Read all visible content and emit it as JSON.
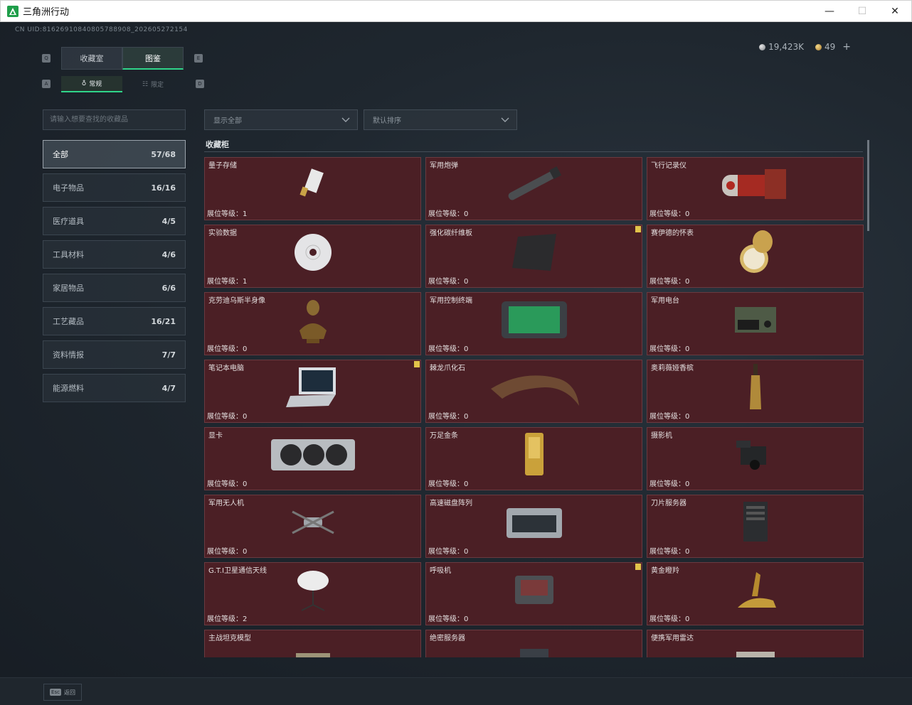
{
  "window": {
    "title": "三角洲行动",
    "minimize_glyph": "—",
    "maximize_glyph": "☐",
    "close_glyph": "✕"
  },
  "header": {
    "uid": "CN UID:8162691084080578890​8_2026052721​54",
    "silver_amount": "19,423K",
    "gold_amount": "49",
    "add_label": "+"
  },
  "tabs": {
    "key_left": "Q",
    "key_right": "E",
    "items": [
      {
        "label": "收藏室",
        "active": false
      },
      {
        "label": "图鉴",
        "active": true
      }
    ]
  },
  "subtabs": {
    "key_left": "A",
    "key_right": "D",
    "items": [
      {
        "label": "常规",
        "active": true
      },
      {
        "label": "限定",
        "active": false
      }
    ]
  },
  "search": {
    "placeholder": "请输入想要查找的收藏品"
  },
  "filters": {
    "display": "显示全部",
    "sort": "默认排序"
  },
  "categories": [
    {
      "label": "全部",
      "count": "57/68",
      "active": true
    },
    {
      "label": "电子物品",
      "count": "16/16",
      "active": false
    },
    {
      "label": "医疗道具",
      "count": "4/5",
      "active": false
    },
    {
      "label": "工具材料",
      "count": "4/6",
      "active": false
    },
    {
      "label": "家居物品",
      "count": "6/6",
      "active": false
    },
    {
      "label": "工艺藏品",
      "count": "16/21",
      "active": false
    },
    {
      "label": "资料情报",
      "count": "7/7",
      "active": false
    },
    {
      "label": "能源燃料",
      "count": "4/7",
      "active": false
    }
  ],
  "cabinet": {
    "title": "收藏柜",
    "level_prefix": "展位等级：",
    "items": [
      {
        "name": "量子存储",
        "level": "1",
        "flag": false,
        "icon": "usb-drive-icon"
      },
      {
        "name": "军用炮弹",
        "level": "0",
        "flag": false,
        "icon": "shell-icon"
      },
      {
        "name": "飞行记录仪",
        "level": "0",
        "flag": false,
        "icon": "flight-recorder-icon"
      },
      {
        "name": "实验数据",
        "level": "1",
        "flag": false,
        "icon": "disc-icon"
      },
      {
        "name": "强化碳纤维板",
        "level": "0",
        "flag": true,
        "icon": "carbon-plate-icon"
      },
      {
        "name": "赛伊德的怀表",
        "level": "0",
        "flag": false,
        "icon": "pocket-watch-icon"
      },
      {
        "name": "克劳迪乌斯半身像",
        "level": "0",
        "flag": false,
        "icon": "bust-icon"
      },
      {
        "name": "军用控制终端",
        "level": "0",
        "flag": false,
        "icon": "terminal-icon"
      },
      {
        "name": "军用电台",
        "level": "0",
        "flag": false,
        "icon": "radio-icon"
      },
      {
        "name": "笔记本电脑",
        "level": "0",
        "flag": true,
        "icon": "laptop-icon"
      },
      {
        "name": "棘龙爪化石",
        "level": "0",
        "flag": false,
        "icon": "claw-fossil-icon"
      },
      {
        "name": "奥莉薇娅香槟",
        "level": "0",
        "flag": false,
        "icon": "champagne-icon"
      },
      {
        "name": "显卡",
        "level": "0",
        "flag": false,
        "icon": "gpu-icon"
      },
      {
        "name": "万足金条",
        "level": "0",
        "flag": false,
        "icon": "gold-bar-icon"
      },
      {
        "name": "摄影机",
        "level": "0",
        "flag": false,
        "icon": "camera-icon"
      },
      {
        "name": "军用无人机",
        "level": "0",
        "flag": false,
        "icon": "drone-icon"
      },
      {
        "name": "高速磁盘阵列",
        "level": "0",
        "flag": false,
        "icon": "disk-array-icon"
      },
      {
        "name": "刀片服务器",
        "level": "0",
        "flag": false,
        "icon": "server-icon"
      },
      {
        "name": "G.T.I卫星通信天线",
        "level": "2",
        "flag": false,
        "icon": "satellite-dish-icon"
      },
      {
        "name": "呼吸机",
        "level": "0",
        "flag": true,
        "icon": "ventilator-icon"
      },
      {
        "name": "黄金瞪羚",
        "level": "0",
        "flag": false,
        "icon": "gold-gazelle-icon"
      },
      {
        "name": "主战坦克模型",
        "level": "",
        "flag": false,
        "icon": "tank-model-icon"
      },
      {
        "name": "绝密服务器",
        "level": "",
        "flag": false,
        "icon": "secret-server-icon"
      },
      {
        "name": "便携军用雷达",
        "level": "",
        "flag": false,
        "icon": "radar-icon"
      }
    ]
  },
  "footer": {
    "esc_key": "Esc",
    "back_label": "返回"
  },
  "colors": {
    "accent": "#2fd58a",
    "card_bg": "#4b1f25",
    "flag": "#e1c34a"
  }
}
